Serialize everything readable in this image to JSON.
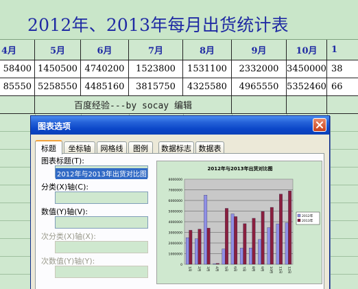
{
  "sheet": {
    "title": "2012年、2013年每月出货统计表",
    "headers": [
      "4月",
      "5月",
      "6月",
      "7月",
      "8月",
      "9月",
      "10月",
      "1"
    ],
    "rows": [
      [
        "58400",
        "1450500",
        "4740200",
        "1523800",
        "1531100",
        "2332000",
        "3450000",
        "38"
      ],
      [
        "85550",
        "5258550",
        "4485160",
        "3815750",
        "4325580",
        "4965550",
        "5352460",
        "66"
      ]
    ],
    "note": "百度经验---by socay 编辑"
  },
  "dialog": {
    "title": "图表选项",
    "tabs": [
      "标题",
      "坐标轴",
      "网格线",
      "图例",
      "数据标志",
      "数据表"
    ],
    "active_tab": "标题",
    "fields": {
      "chart_title_label": "图表标题(T):",
      "chart_title_value": "2012年与2013年出货对比图",
      "category_x_label": "分类(X)轴(C):",
      "value_y_label": "数值(Y)轴(V):",
      "secondary_category_label": "次分类(X)轴(X):",
      "secondary_value_label": "次数值(Y)轴(Y):"
    }
  },
  "colors": {
    "sheet_bg": "#cfe8cf",
    "title_text": "#1f2aa3",
    "series_2012": "#8f8fe6",
    "series_2013": "#8a1f3e"
  },
  "chart_data": {
    "type": "bar",
    "title": "2012年与2013年出货对比图",
    "categories": [
      "1月",
      "2月",
      "3月",
      "4月",
      "5月",
      "6月",
      "7月",
      "8月",
      "9月",
      "10月",
      "11月",
      "12月"
    ],
    "ylim": [
      0,
      8000000
    ],
    "yticks": [
      "8000000",
      "7000000",
      "6000000",
      "5000000",
      "4000000",
      "3000000",
      "2000000",
      "1000000",
      "0"
    ],
    "series": [
      {
        "name": "2012年",
        "values": [
          2500000,
          2400000,
          6500000,
          58400,
          1450500,
          4740200,
          1523800,
          1531100,
          2332000,
          3450000,
          3800000,
          3900000
        ]
      },
      {
        "name": "2013年",
        "values": [
          3200000,
          3300000,
          3400000,
          85550,
          5258550,
          4485160,
          3815750,
          4325580,
          4965550,
          5352460,
          6600000,
          6900000
        ]
      }
    ],
    "legend_position": "right",
    "grid": true
  }
}
